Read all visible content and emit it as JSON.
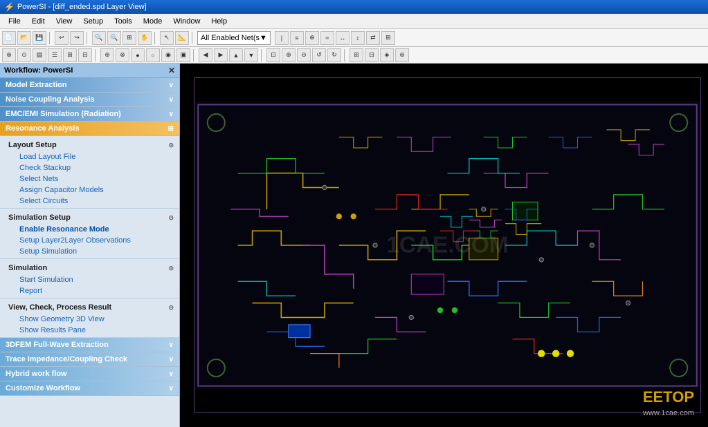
{
  "titlebar": {
    "icon": "⚡",
    "title": "PowerSI - [diff_ended.spd Layer View]"
  },
  "menubar": {
    "items": [
      "File",
      "Edit",
      "View",
      "Setup",
      "Tools",
      "Mode",
      "Window",
      "Help"
    ]
  },
  "toolbar": {
    "all_enabled_label": "All Enabled Net(s",
    "dropdown_arrow": "▼"
  },
  "workflow": {
    "label": "Workflow: PowerSI",
    "close_btn": "✕",
    "sections": [
      {
        "id": "model-extraction",
        "label": "Model Extraction",
        "style": "blue-gradient",
        "expanded": false
      },
      {
        "id": "noise-coupling",
        "label": "Noise Coupling Analysis",
        "style": "blue-gradient",
        "expanded": false
      },
      {
        "id": "emc-emi",
        "label": "EMC/EMI Simulation (Radiation)",
        "style": "blue-gradient",
        "expanded": false
      },
      {
        "id": "resonance",
        "label": "Resonance Analysis",
        "style": "orange-active",
        "expanded": true
      }
    ],
    "resonance_subsections": [
      {
        "id": "layout-setup",
        "label": "Layout Setup",
        "items": [
          "Load Layout File",
          "Check Stackup",
          "Select Nets",
          "Assign Capacitor Models",
          "Select Circuits"
        ]
      },
      {
        "id": "simulation-setup",
        "label": "Simulation Setup",
        "items": [
          "Enable Resonance Mode",
          "Setup Layer2Layer Observations",
          "Setup Simulation"
        ]
      },
      {
        "id": "simulation",
        "label": "Simulation",
        "items": [
          "Start Simulation",
          "Report"
        ]
      },
      {
        "id": "view-check",
        "label": "View, Check, Process Result",
        "items": [
          "Show Geometry 3D View",
          "Show Results Pane"
        ]
      }
    ],
    "bottom_sections": [
      {
        "id": "3dfem",
        "label": "3DFEM Full-Wave Extraction",
        "style": "light-blue"
      },
      {
        "id": "trace-impedance",
        "label": "Trace Impedance/Coupling Check",
        "style": "light-blue"
      },
      {
        "id": "hybrid",
        "label": "Hybrid work flow",
        "style": "light-blue"
      },
      {
        "id": "customize",
        "label": "Customize Workflow",
        "style": "light-blue"
      }
    ]
  },
  "pcb": {
    "watermark": "1CAE.COM",
    "eetop": "EETOP",
    "url": "www.1cae.com"
  },
  "icons": {
    "arrow_down": "▼",
    "arrow_up": "▲",
    "circle_up": "⊙",
    "chevron_right": "›"
  }
}
